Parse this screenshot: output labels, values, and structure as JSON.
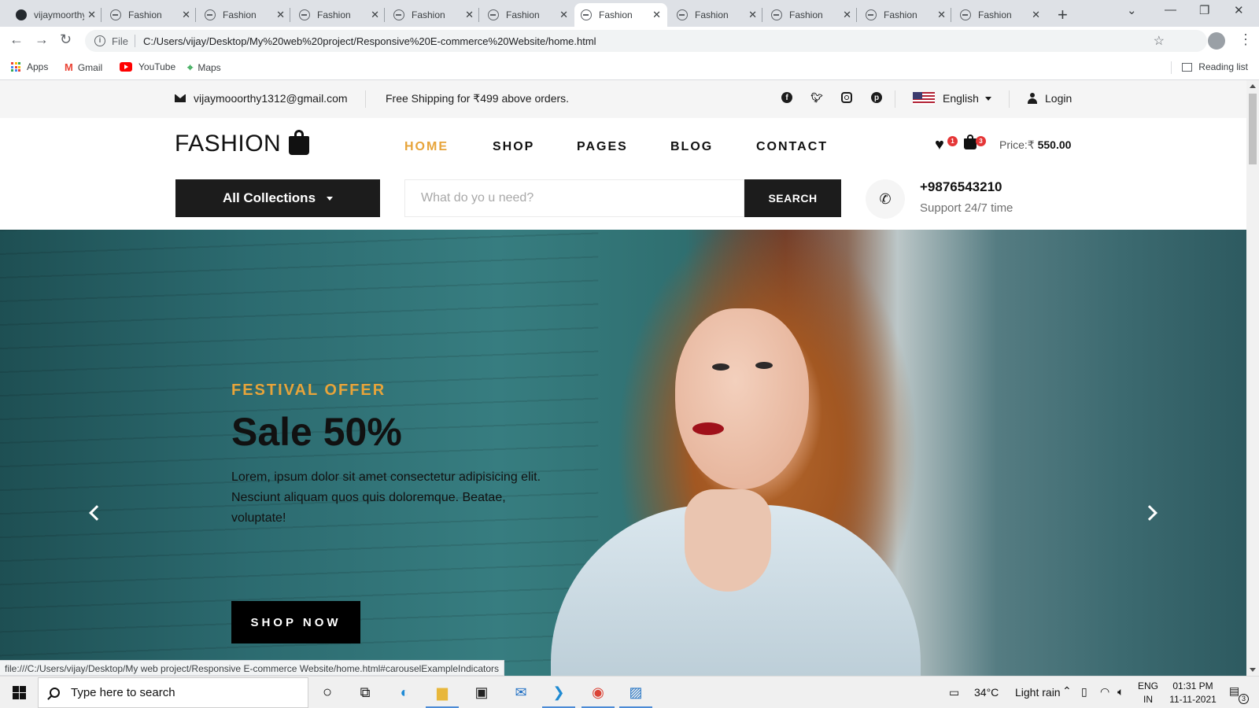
{
  "browser": {
    "tabs": [
      {
        "title": "vijaymoorthy",
        "icon": "github-icon",
        "active": false
      },
      {
        "title": "Fashion",
        "icon": "globe-icon",
        "active": false
      },
      {
        "title": "Fashion",
        "icon": "globe-icon",
        "active": false
      },
      {
        "title": "Fashion",
        "icon": "globe-icon",
        "active": false
      },
      {
        "title": "Fashion",
        "icon": "globe-icon",
        "active": false
      },
      {
        "title": "Fashion",
        "icon": "globe-icon",
        "active": false
      },
      {
        "title": "Fashion",
        "icon": "globe-icon",
        "active": true
      },
      {
        "title": "Fashion",
        "icon": "globe-icon",
        "active": false
      },
      {
        "title": "Fashion",
        "icon": "globe-icon",
        "active": false
      },
      {
        "title": "Fashion",
        "icon": "globe-icon",
        "active": false
      },
      {
        "title": "Fashion",
        "icon": "globe-icon",
        "active": false
      }
    ],
    "address": {
      "scheme_label": "File",
      "url": "C:/Users/vijay/Desktop/My%20web%20project/Responsive%20E-commerce%20Website/home.html"
    },
    "bookmarks": [
      "Apps",
      "Gmail",
      "YouTube",
      "Maps"
    ],
    "reading_list": "Reading list",
    "status_url": "file:///C:/Users/vijay/Desktop/My web project/Responsive E-commerce Website/home.html#carouselExampleIndicators"
  },
  "site": {
    "topbar": {
      "email": "vijaymooorthy1312@gmail.com",
      "shipping": "Free Shipping for ₹499 above orders.",
      "social": [
        "facebook-icon",
        "twitter-icon",
        "instagram-icon",
        "pinterest-icon"
      ],
      "language": "English",
      "login": "Login"
    },
    "logo": "FASHION",
    "nav": [
      "HOME",
      "SHOP",
      "PAGES",
      "BLOG",
      "CONTACT"
    ],
    "active_nav": "HOME",
    "wishlist_count": "1",
    "cart_count": "3",
    "price_label": "Price:₹",
    "price_value": "550.00",
    "collections": "All Collections",
    "search": {
      "placeholder": "What do yo u need?",
      "button": "SEARCH"
    },
    "phone": "+9876543210",
    "support": "Support 24/7 time",
    "hero": {
      "offer": "FESTIVAL OFFER",
      "title": "Sale 50%",
      "text": "Lorem, ipsum dolor sit amet consectetur adipisicing elit. Nesciunt aliquam quos quis doloremque. Beatae, voluptate!",
      "button": "SHOP NOW"
    },
    "colors": {
      "accent": "#e7a43a",
      "dark": "#1c1c1c",
      "badge": "#e53637"
    }
  },
  "taskbar": {
    "search_placeholder": "Type here to search",
    "apps": [
      "cortana-icon",
      "task-view-icon",
      "edge-icon",
      "file-explorer-icon",
      "store-icon",
      "mail-icon",
      "vscode-icon",
      "chrome-icon",
      "photos-icon"
    ],
    "weather_temp": "34°C",
    "weather_desc": "Light rain",
    "lang_top": "ENG",
    "lang_bottom": "IN",
    "time": "01:31 PM",
    "date": "11-11-2021",
    "notifications": "3"
  }
}
